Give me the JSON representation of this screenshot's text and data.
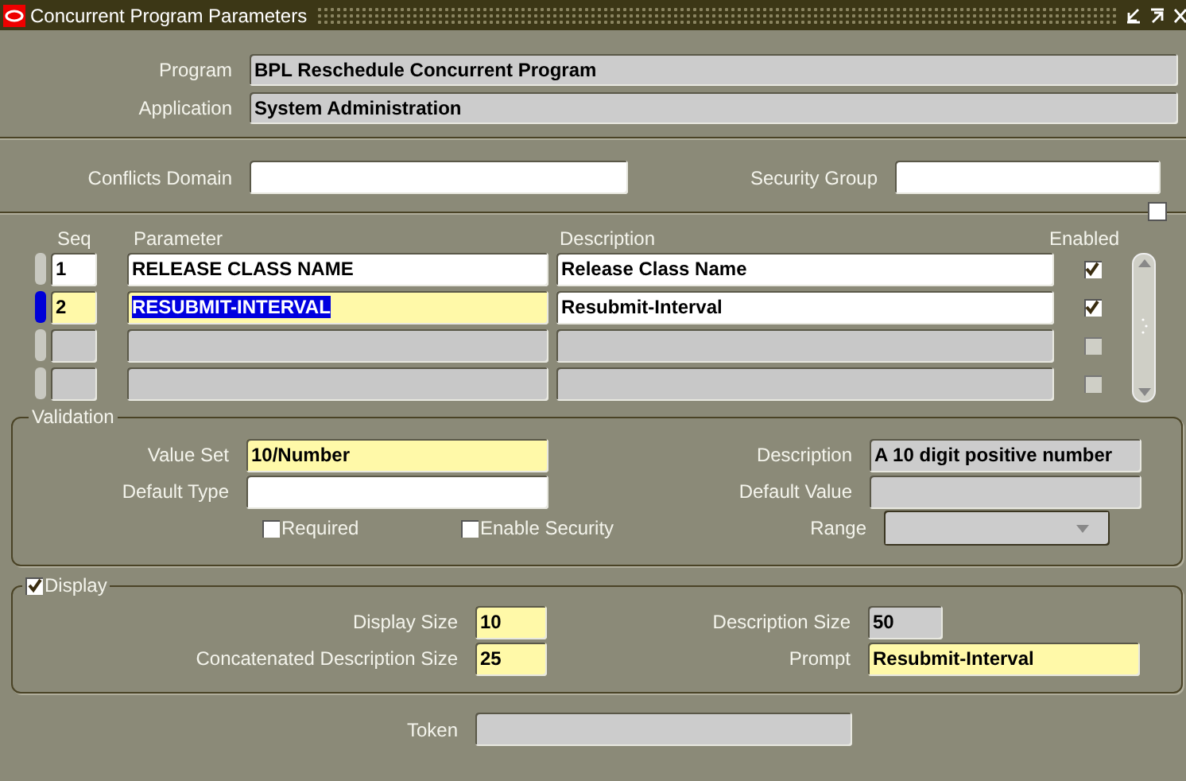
{
  "window": {
    "title": "Concurrent Program Parameters"
  },
  "header": {
    "fields": [
      {
        "label": "Program",
        "value": "BPL Reschedule Concurrent Program",
        "kind": "readonly"
      },
      {
        "label": "Application",
        "value": "System Administration",
        "kind": "readonly"
      }
    ]
  },
  "security": {
    "fields": [
      {
        "label": "Conflicts Domain",
        "kind": "text"
      },
      {
        "label": "Security Group",
        "kind": "text"
      }
    ]
  },
  "parameters": {
    "columns": [
      "Seq",
      "Parameter",
      "Description",
      "Enabled"
    ],
    "rows": [
      {
        "seq": "1",
        "parameter": "RELEASE CLASS NAME",
        "description": "Release Class Name",
        "enabled": true,
        "selected": false
      },
      {
        "seq": "2",
        "parameter": "RESUBMIT-INTERVAL",
        "description": "Resubmit-Interval",
        "enabled": true,
        "selected": true
      },
      {
        "enabled": false,
        "selected": false
      },
      {
        "enabled": false,
        "selected": false
      }
    ]
  },
  "validation": {
    "legend": "Validation",
    "left": [
      {
        "label": "Value Set",
        "value": "10/Number",
        "kind": "required"
      },
      {
        "label": "Default Type",
        "kind": "text"
      }
    ],
    "checkboxes": [
      {
        "label": "Required",
        "checked": false
      },
      {
        "label": "Enable Security",
        "checked": false
      }
    ],
    "right": [
      {
        "label": "Description",
        "value": "A 10 digit positive number",
        "kind": "readonly"
      },
      {
        "label": "Default Value",
        "kind": "readonly"
      },
      {
        "label": "Range",
        "kind": "dropdown"
      }
    ]
  },
  "display": {
    "legend": "Display",
    "checked": true,
    "left": [
      {
        "label": "Display Size",
        "value": "10",
        "kind": "required"
      },
      {
        "label": "Concatenated Description Size",
        "value": "25",
        "kind": "required"
      }
    ],
    "right": [
      {
        "label": "Description Size",
        "value": "50",
        "kind": "readonly"
      },
      {
        "label": "Prompt",
        "value": "Resubmit-Interval",
        "kind": "required"
      }
    ]
  },
  "token": {
    "label": "Token",
    "kind": "readonly"
  }
}
